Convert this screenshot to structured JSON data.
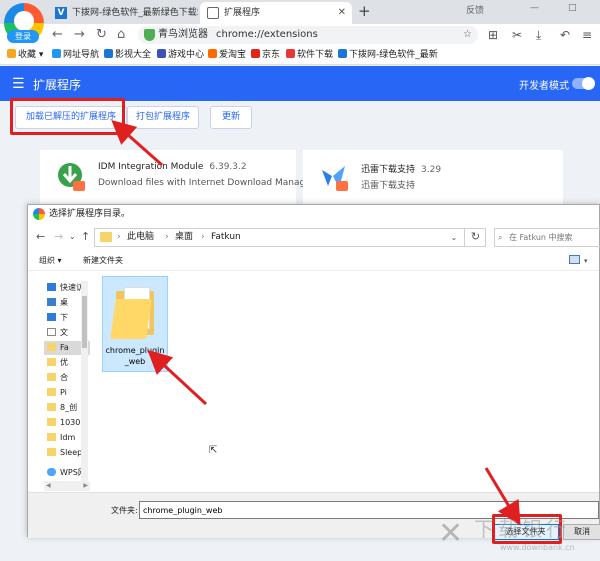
{
  "browser": {
    "login_badge": "登录",
    "tabs": [
      {
        "label": "下拨网-绿色软件_最新绿色下载站",
        "favicon": "V",
        "active": false
      },
      {
        "label": "扩展程序",
        "active": true
      }
    ],
    "window_controls": {
      "feedback": "反馈",
      "minimize": "—",
      "restore": "□"
    },
    "address": {
      "browser_name": "青鸟浏览器",
      "url": "chrome://extensions"
    },
    "bookmarks": [
      {
        "label": "收藏",
        "color": "#f5a623"
      },
      {
        "label": "网址导航",
        "color": "#2196f3"
      },
      {
        "label": "影视大全",
        "color": "#1976d2"
      },
      {
        "label": "游戏中心",
        "color": "#3f51b5"
      },
      {
        "label": "爱淘宝",
        "color": "#ff6a00"
      },
      {
        "label": "京东",
        "color": "#e1251b"
      },
      {
        "label": "软件下载",
        "color": "#e53935"
      },
      {
        "label": "下拨网-绿色软件_最新",
        "color": "#1976d2"
      }
    ]
  },
  "extensions": {
    "title": "扩展程序",
    "developer_mode_label": "开发者模式",
    "developer_mode_on": true,
    "buttons": {
      "load_unpacked": "加载已解压的扩展程序",
      "pack": "打包扩展程序",
      "update": "更新"
    },
    "cards": [
      {
        "name": "IDM Integration Module",
        "version": "6.39.3.2",
        "description": "Download files with Internet Download Manager"
      },
      {
        "name": "迅雷下载支持",
        "version": "3.29",
        "description": "迅雷下载支持"
      }
    ]
  },
  "dialog": {
    "title": "选择扩展程序目录。",
    "path": [
      "此电脑",
      "桌面",
      "Fatkun"
    ],
    "search_placeholder": "在 Fatkun 中搜索",
    "organize": "组织 ▾",
    "new_folder": "新建文件夹",
    "sidebar": [
      "快速访",
      "桌",
      "下",
      "文",
      "Fa",
      "优",
      "合",
      "Pi",
      "8_创",
      "1030",
      "Idm",
      "Sleep",
      "WPS网"
    ],
    "files": [
      {
        "name": "chrome_plugin_web"
      }
    ],
    "filename_label": "文件夹:",
    "filename_value": "chrome_plugin_web",
    "select_button": "选择文件夹",
    "cancel_button": "取消"
  },
  "watermark": {
    "text": "下载银行",
    "url": "www.downbank.cn"
  },
  "colors": {
    "accent": "#2866f6",
    "annotation_red": "#e02020"
  }
}
